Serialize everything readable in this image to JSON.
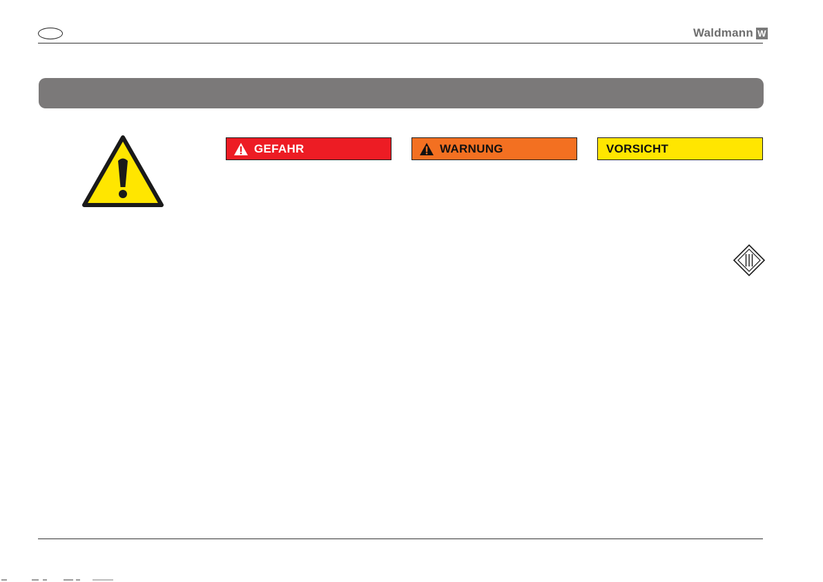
{
  "header": {
    "brand": {
      "name": "Waldmann",
      "mark": "W"
    }
  },
  "signal_words": {
    "danger": {
      "label": "GEFAHR",
      "color": "#ed1c24"
    },
    "warning": {
      "label": "WARNUNG",
      "color": "#f37021"
    },
    "caution": {
      "label": "VORSICHT",
      "color": "#ffe600"
    }
  },
  "icons": {
    "general_warning": "warning-triangle-exclamation",
    "protection_class": "protection-class-iii"
  },
  "colors": {
    "section_bar": "#7b7979",
    "warning_yellow": "#ffe600"
  }
}
